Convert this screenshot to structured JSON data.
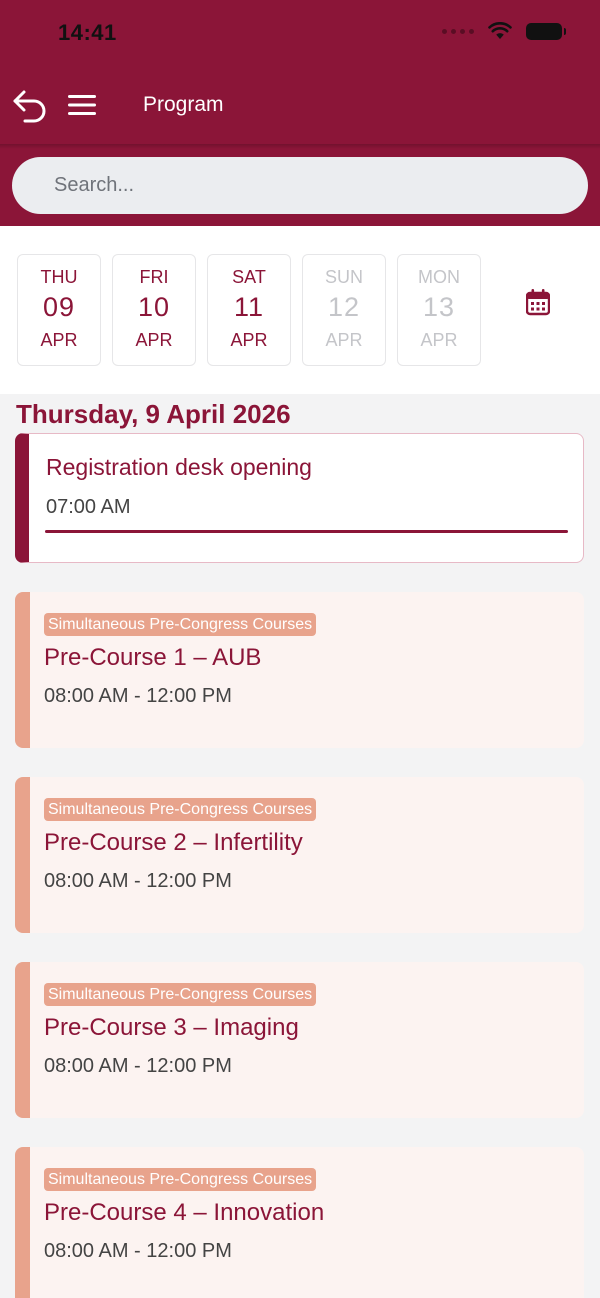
{
  "status_bar": {
    "time": "14:41"
  },
  "nav": {
    "title": "Program"
  },
  "search": {
    "placeholder": "Search..."
  },
  "date_strip": {
    "days": [
      {
        "dow": "THU",
        "day": "09",
        "mon": "APR",
        "enabled": true
      },
      {
        "dow": "FRI",
        "day": "10",
        "mon": "APR",
        "enabled": true
      },
      {
        "dow": "SAT",
        "day": "11",
        "mon": "APR",
        "enabled": true
      },
      {
        "dow": "SUN",
        "day": "12",
        "mon": "APR",
        "enabled": false
      },
      {
        "dow": "MON",
        "day": "13",
        "mon": "APR",
        "enabled": false
      }
    ],
    "calendar_icon": "calendar-icon"
  },
  "program": {
    "day_heading": "Thursday, 9 April 2026",
    "events": [
      {
        "title": "Registration desk opening",
        "time": "07:00 AM"
      }
    ],
    "courses": [
      {
        "tag": "Simultaneous Pre-Congress Courses",
        "title": "Pre-Course 1 – AUB",
        "time": "08:00 AM - 12:00 PM"
      },
      {
        "tag": "Simultaneous Pre-Congress Courses",
        "title": "Pre-Course 2 – Infertility",
        "time": "08:00 AM - 12:00 PM"
      },
      {
        "tag": "Simultaneous Pre-Congress Courses",
        "title": "Pre-Course 3 – Imaging",
        "time": "08:00 AM - 12:00 PM"
      },
      {
        "tag": "Simultaneous Pre-Congress Courses",
        "title": "Pre-Course 4 – Innovation",
        "time": "08:00 AM - 12:00 PM"
      }
    ]
  },
  "colors": {
    "brand": "#8b1538",
    "course_accent": "#e8a38c",
    "course_bg": "#fcf3f1"
  }
}
